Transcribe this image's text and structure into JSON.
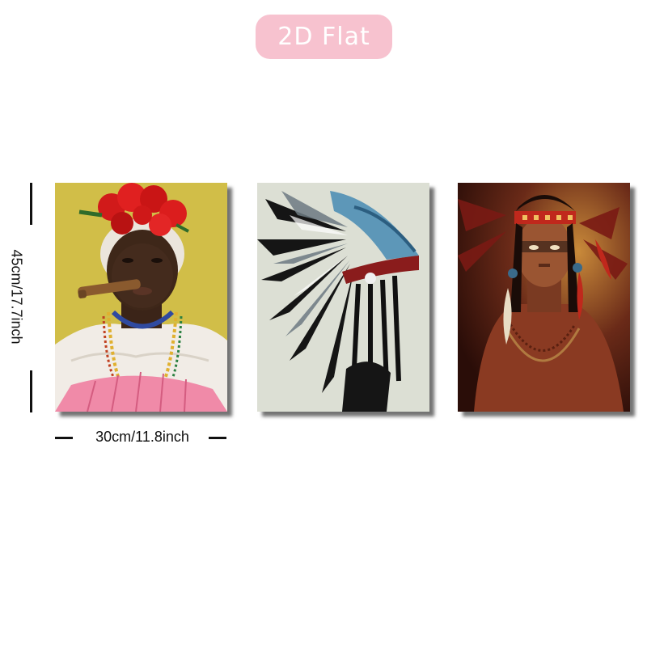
{
  "badge": {
    "text": "2D Flat"
  },
  "dimensions": {
    "height_label": "45cm/17.7inch",
    "width_label": "30cm/11.8inch"
  },
  "panels": [
    {
      "subject": "portrait-woman-flower-crown-cigar"
    },
    {
      "subject": "watercolor-feather-headdress"
    },
    {
      "subject": "portrait-man-feather-headdress"
    }
  ],
  "colors": {
    "badge_bg": "#f7c2cf",
    "badge_text": "#ffffff"
  }
}
